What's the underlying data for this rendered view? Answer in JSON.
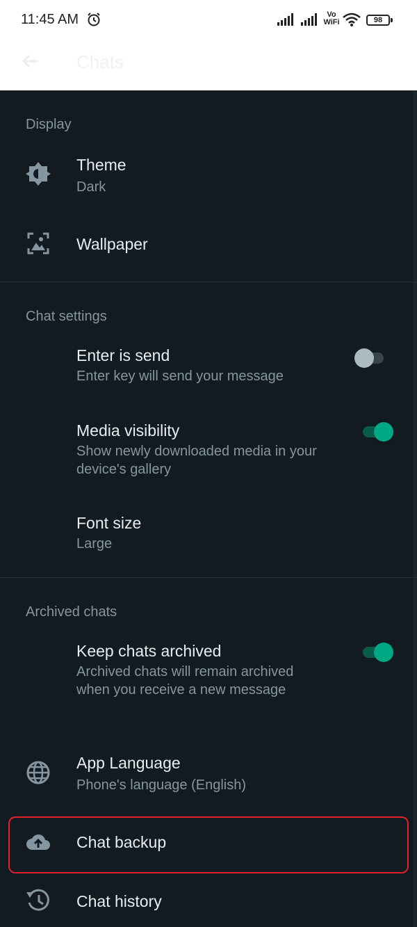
{
  "status_bar": {
    "time": "11:45 AM",
    "network": "Vo\nWiFi",
    "battery": "98"
  },
  "header": {
    "title": "Chats"
  },
  "sections": {
    "display": {
      "label": "Display",
      "theme": {
        "title": "Theme",
        "value": "Dark"
      },
      "wallpaper": {
        "title": "Wallpaper"
      }
    },
    "chat_settings": {
      "label": "Chat settings",
      "enter_is_send": {
        "title": "Enter is send",
        "subtitle": "Enter key will send your message",
        "enabled": false
      },
      "media_visibility": {
        "title": "Media visibility",
        "subtitle": "Show newly downloaded media in your device's gallery",
        "enabled": true
      },
      "font_size": {
        "title": "Font size",
        "value": "Large"
      }
    },
    "archived_chats": {
      "label": "Archived chats",
      "keep_archived": {
        "title": "Keep chats archived",
        "subtitle": "Archived chats will remain archived when you receive a new message",
        "enabled": true
      }
    },
    "other": {
      "app_language": {
        "title": "App Language",
        "value": "Phone's language (English)"
      },
      "chat_backup": {
        "title": "Chat backup"
      },
      "chat_history": {
        "title": "Chat history"
      }
    }
  },
  "colors": {
    "background": "#121b22",
    "accent": "#00a884",
    "highlight": "#e0202a"
  }
}
